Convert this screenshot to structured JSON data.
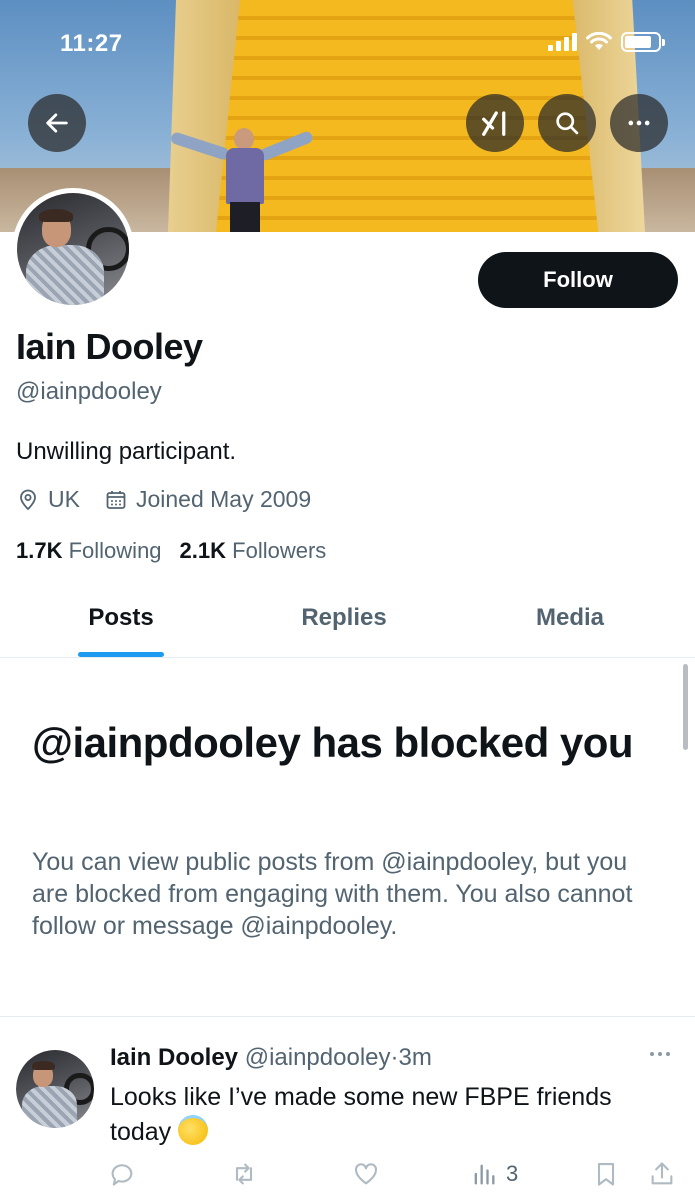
{
  "status_bar": {
    "time": "11:27"
  },
  "profile": {
    "display_name": "Iain Dooley",
    "handle": "@iainpdooley",
    "bio": "Unwilling participant.",
    "location": "UK",
    "joined": "Joined May 2009",
    "following_count": "1.7K",
    "following_label": "Following",
    "followers_count": "2.1K",
    "followers_label": "Followers",
    "follow_button": "Follow"
  },
  "tabs": [
    {
      "label": "Posts",
      "active": true
    },
    {
      "label": "Replies",
      "active": false
    },
    {
      "label": "Media",
      "active": false
    }
  ],
  "blocked": {
    "title": "@iainpdooley has blocked you",
    "description": "You can view public posts from @iainpdooley, but you are blocked from engaging with them. You also cannot follow or message @iainpdooley."
  },
  "post": {
    "author": "Iain Dooley",
    "handle": "@iainpdooley",
    "separator": "·",
    "time": "3m",
    "text": "Looks like I’ve made some new FBPE friends today",
    "views": "3"
  },
  "colors": {
    "accent": "#1d9bf0",
    "text_primary": "#0f1419",
    "text_secondary": "#536471",
    "follow_button_bg": "#0f1419"
  },
  "icons": {
    "back": "arrow-left-icon",
    "grok": "grok-icon",
    "search": "search-icon",
    "more": "more-dots-icon",
    "location": "location-pin-icon",
    "calendar": "calendar-icon"
  }
}
